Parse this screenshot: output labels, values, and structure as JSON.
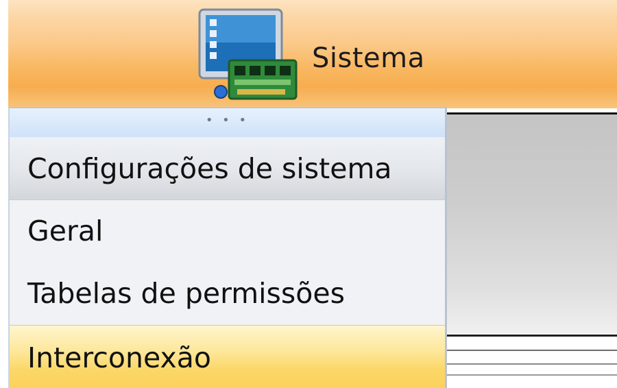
{
  "ribbon": {
    "button_label": "Sistema",
    "icon": "computer-network-icon"
  },
  "menu": {
    "gripper": "• • •",
    "items": [
      {
        "label": "Configurações de sistema",
        "kind": "header"
      },
      {
        "label": "Geral"
      },
      {
        "label": "Tabelas de permissões"
      },
      {
        "label": "Interconexão",
        "state": "hovered"
      }
    ]
  },
  "colors": {
    "ribbon_orange": "#f9b862",
    "menu_bg": "#f0f2f5",
    "hover_yellow": "#fbd767",
    "gripper_blue": "#cfe2f8"
  }
}
